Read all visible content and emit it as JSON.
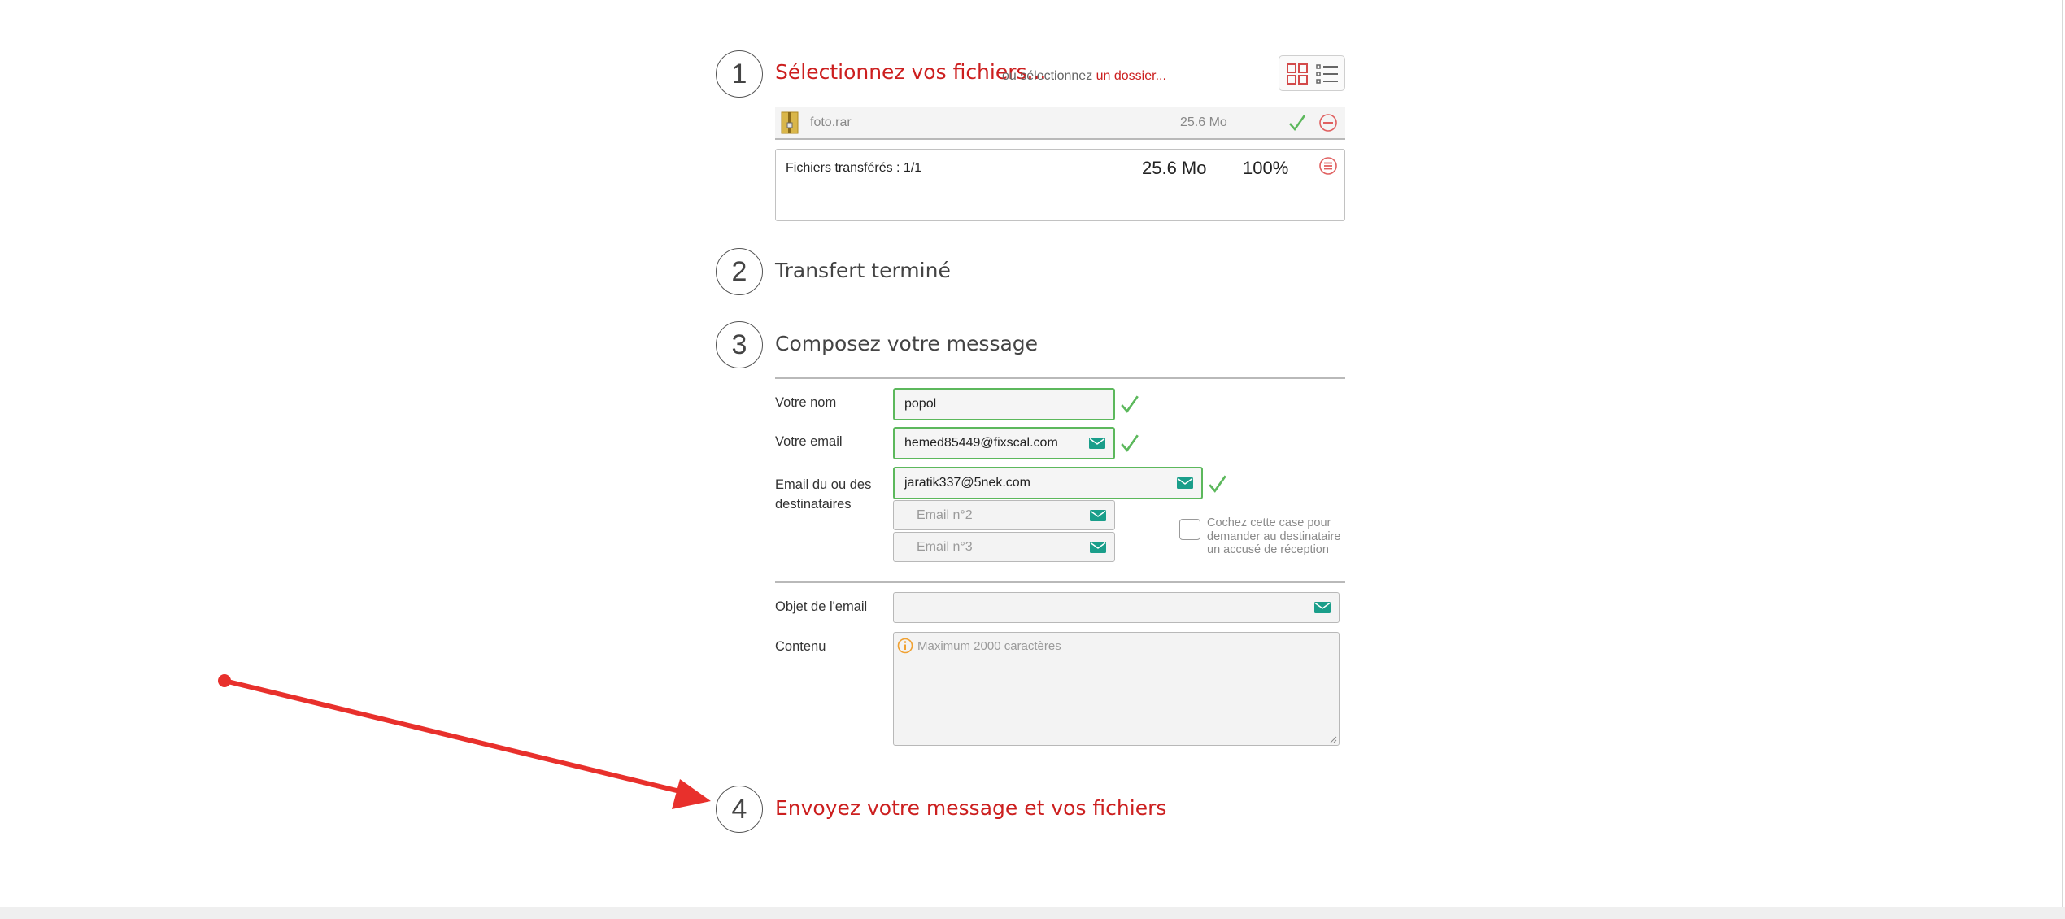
{
  "step1": {
    "number": "1",
    "title": "Sélectionnez vos fichiers...",
    "or_text": "ou sélectionnez",
    "folder_link": "un dossier..."
  },
  "file": {
    "name": "foto.rar",
    "size": "25.6 Mo"
  },
  "transfer": {
    "label": "Fichiers transférés : 1/1",
    "size": "25.6 Mo",
    "percent": "100%"
  },
  "step2": {
    "number": "2",
    "title": "Transfert terminé"
  },
  "step3": {
    "number": "3",
    "title": "Composez votre message"
  },
  "form": {
    "name_label": "Votre nom",
    "name_value": "popol",
    "email_label": "Votre email",
    "email_value": "hemed85449@fixscal.com",
    "recipients_label_1": "Email du ou des",
    "recipients_label_2": "destinataires",
    "recipient1_value": "jaratik337@5nek.com",
    "recipient2_placeholder": "Email n°2",
    "recipient3_placeholder": "Email n°3",
    "receipt_text_1": "Cochez cette case pour",
    "receipt_text_2": "demander au destinataire",
    "receipt_text_3": "un accusé de réception",
    "subject_label": "Objet de l'email",
    "subject_value": "",
    "content_label": "Contenu",
    "content_placeholder": "Maximum 2000 caractères"
  },
  "step4": {
    "number": "4",
    "title": "Envoyez votre message et vos fichiers"
  },
  "colors": {
    "accent_red": "#cc1f1f",
    "success_green": "#5cb85c",
    "mail_icon_teal": "#1a9e8a",
    "annotation_arrow": "#e8302c"
  }
}
